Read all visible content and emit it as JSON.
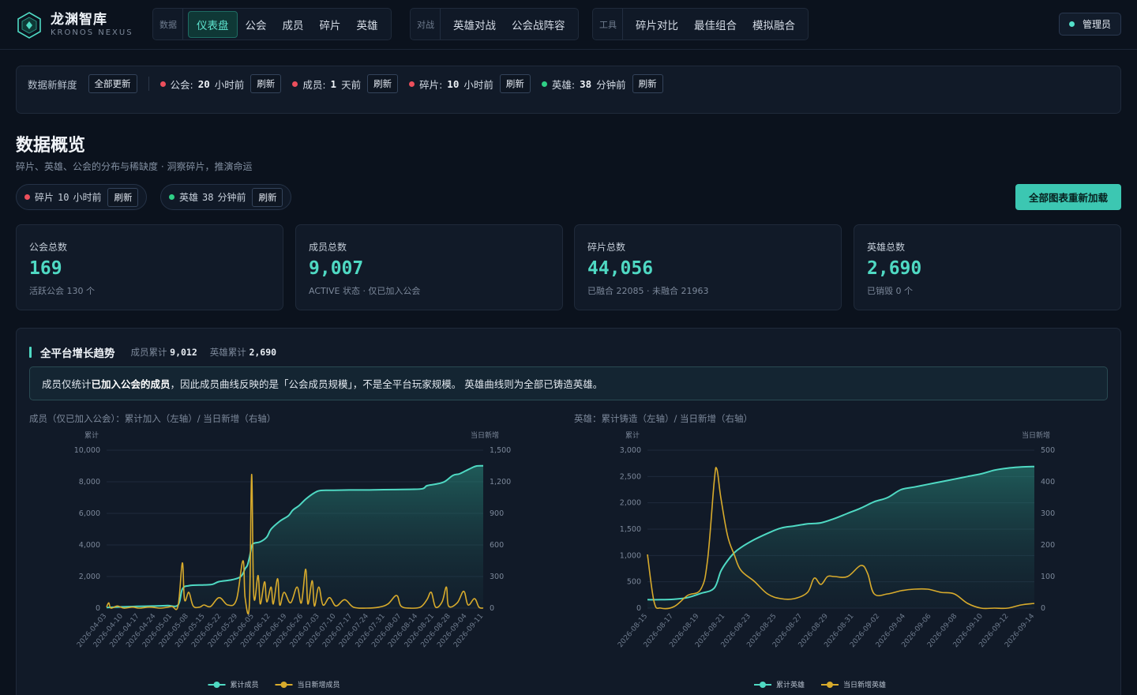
{
  "brand": {
    "name": "龙渊智库",
    "sub": "KRONOS NEXUS"
  },
  "nav": {
    "groups": [
      {
        "label": "数据",
        "items": [
          "仪表盘",
          "公会",
          "成员",
          "碎片",
          "英雄"
        ],
        "active": 0
      },
      {
        "label": "对战",
        "items": [
          "英雄对战",
          "公会战阵容"
        ]
      },
      {
        "label": "工具",
        "items": [
          "碎片对比",
          "最佳组合",
          "模拟融合"
        ]
      }
    ],
    "admin": "管理员"
  },
  "freshness": {
    "label": "数据新鲜度",
    "update_all": "全部更新",
    "items": [
      {
        "name": "公会:",
        "num": "20",
        "unit": "小时前",
        "status": "red",
        "action": "刷新"
      },
      {
        "name": "成员:",
        "num": "1",
        "unit": "天前",
        "status": "red",
        "action": "刷新"
      },
      {
        "name": "碎片:",
        "num": "10",
        "unit": "小时前",
        "status": "red",
        "action": "刷新"
      },
      {
        "name": "英雄:",
        "num": "38",
        "unit": "分钟前",
        "status": "green",
        "action": "刷新"
      }
    ]
  },
  "page": {
    "title": "数据概览",
    "subtitle": "碎片、英雄、公会的分布与稀缺度 · 洞察碎片，推演命运",
    "pills": [
      {
        "name": "碎片",
        "num": "10",
        "unit": "小时前",
        "status": "red",
        "action": "刷新"
      },
      {
        "name": "英雄",
        "num": "38",
        "unit": "分钟前",
        "status": "green",
        "action": "刷新"
      }
    ],
    "reload_all": "全部图表重新加载"
  },
  "stats": [
    {
      "label": "公会总数",
      "value": "169",
      "note": "活跃公会 130 个"
    },
    {
      "label": "成员总数",
      "value": "9,007",
      "note": "ACTIVE 状态 · 仅已加入公会"
    },
    {
      "label": "碎片总数",
      "value": "44,056",
      "note": "已融合 22085 · 未融合 21963"
    },
    {
      "label": "英雄总数",
      "value": "2,690",
      "note": "已销毁 0 个"
    }
  ],
  "growth": {
    "title": "全平台增长趋势",
    "member_total_label": "成员累计",
    "member_total": "9,012",
    "hero_total_label": "英雄累计",
    "hero_total": "2,690",
    "note_pre": "成员仅统计",
    "note_bold": "已加入公会的成员",
    "note_post": "，因此成员曲线反映的是「公会成员规模」，不是全平台玩家规模。 英雄曲线则为全部已铸造英雄。"
  },
  "chart_data": [
    {
      "type": "line",
      "title": "成员（仅已加入公会）：累计加入（左轴）/ 当日新增（右轴）",
      "left_axis_label": "累计",
      "right_axis_label": "当日新增",
      "ylim_left": [
        0,
        10000
      ],
      "ylim_right": [
        0,
        1500
      ],
      "left_ticks": [
        "0",
        "2,000",
        "4,000",
        "6,000",
        "8,000",
        "10,000"
      ],
      "right_ticks": [
        "0",
        "300",
        "600",
        "900",
        "1,200",
        "1,500"
      ],
      "x_labels": [
        "2026-04-03",
        "2026-04-10",
        "2026-04-17",
        "2026-04-24",
        "2026-05-01",
        "2026-05-08",
        "2026-05-15",
        "2026-05-22",
        "2026-05-29",
        "2026-06-05",
        "2026-06-12",
        "2026-06-19",
        "2026-06-26",
        "2026-07-03",
        "2026-07-10",
        "2026-07-17",
        "2026-07-24",
        "2026-07-31",
        "2026-08-07",
        "2026-08-14",
        "2026-08-21",
        "2026-08-28",
        "2026-09-04",
        "2026-09-11"
      ],
      "colors": {
        "cumulative": "#4fd9c3",
        "daily": "#d8ab2c"
      },
      "series": [
        {
          "name": "累计成员",
          "axis": "left",
          "points": [
            [
              0,
              40
            ],
            [
              7,
              80
            ],
            [
              14,
              110
            ],
            [
              21,
              130
            ],
            [
              28,
              160
            ],
            [
              33,
              200
            ],
            [
              35,
              1200
            ],
            [
              38,
              1420
            ],
            [
              45,
              1470
            ],
            [
              49,
              1510
            ],
            [
              52,
              1680
            ],
            [
              58,
              1800
            ],
            [
              62,
              2000
            ],
            [
              64,
              2500
            ],
            [
              65,
              2700
            ],
            [
              66,
              3200
            ],
            [
              67,
              3900
            ],
            [
              68,
              4100
            ],
            [
              71,
              4200
            ],
            [
              74,
              4500
            ],
            [
              76,
              5000
            ],
            [
              80,
              5500
            ],
            [
              84,
              5850
            ],
            [
              86,
              6200
            ],
            [
              89,
              6500
            ],
            [
              92,
              6900
            ],
            [
              96,
              7300
            ],
            [
              99,
              7450
            ],
            [
              105,
              7460
            ],
            [
              112,
              7480
            ],
            [
              120,
              7480
            ],
            [
              128,
              7500
            ],
            [
              140,
              7520
            ],
            [
              146,
              7560
            ],
            [
              148,
              7750
            ],
            [
              152,
              7850
            ],
            [
              156,
              8000
            ],
            [
              160,
              8400
            ],
            [
              163,
              8500
            ],
            [
              166,
              8700
            ],
            [
              169,
              8900
            ],
            [
              171,
              9000
            ],
            [
              174,
              9012
            ]
          ]
        },
        {
          "name": "当日新增成员",
          "axis": "right",
          "points": [
            [
              0,
              10
            ],
            [
              1,
              50
            ],
            [
              2,
              0
            ],
            [
              5,
              20
            ],
            [
              8,
              0
            ],
            [
              12,
              10
            ],
            [
              15,
              0
            ],
            [
              20,
              10
            ],
            [
              25,
              0
            ],
            [
              30,
              15
            ],
            [
              33,
              20
            ],
            [
              35,
              430
            ],
            [
              36,
              80
            ],
            [
              38,
              150
            ],
            [
              40,
              20
            ],
            [
              43,
              10
            ],
            [
              45,
              30
            ],
            [
              48,
              15
            ],
            [
              52,
              100
            ],
            [
              56,
              30
            ],
            [
              60,
              80
            ],
            [
              63,
              450
            ],
            [
              64,
              100
            ],
            [
              66,
              40
            ],
            [
              67,
              1270
            ],
            [
              68,
              120
            ],
            [
              70,
              310
            ],
            [
              71,
              40
            ],
            [
              73,
              250
            ],
            [
              74,
              60
            ],
            [
              76,
              200
            ],
            [
              77,
              40
            ],
            [
              79,
              280
            ],
            [
              80,
              30
            ],
            [
              82,
              150
            ],
            [
              85,
              50
            ],
            [
              88,
              200
            ],
            [
              90,
              50
            ],
            [
              92,
              370
            ],
            [
              93,
              40
            ],
            [
              95,
              260
            ],
            [
              96,
              20
            ],
            [
              98,
              200
            ],
            [
              100,
              30
            ],
            [
              103,
              100
            ],
            [
              106,
              20
            ],
            [
              110,
              80
            ],
            [
              114,
              10
            ],
            [
              120,
              0
            ],
            [
              126,
              10
            ],
            [
              130,
              40
            ],
            [
              134,
              120
            ],
            [
              136,
              20
            ],
            [
              140,
              0
            ],
            [
              145,
              10
            ],
            [
              148,
              80
            ],
            [
              150,
              150
            ],
            [
              152,
              10
            ],
            [
              155,
              60
            ],
            [
              157,
              200
            ],
            [
              158,
              20
            ],
            [
              162,
              50
            ],
            [
              165,
              160
            ],
            [
              167,
              30
            ],
            [
              170,
              90
            ],
            [
              172,
              10
            ],
            [
              174,
              0
            ]
          ]
        }
      ]
    },
    {
      "type": "line",
      "title": "英雄：累计铸造（左轴）/ 当日新增（右轴）",
      "left_axis_label": "累计",
      "right_axis_label": "当日新增",
      "ylim_left": [
        0,
        3000
      ],
      "ylim_right": [
        0,
        500
      ],
      "left_ticks": [
        "0",
        "500",
        "1,000",
        "1,500",
        "2,000",
        "2,500",
        "3,000"
      ],
      "right_ticks": [
        "0",
        "100",
        "200",
        "300",
        "400",
        "500"
      ],
      "x_labels": [
        "2026-08-15",
        "2026-08-17",
        "2026-08-19",
        "2026-08-21",
        "2026-08-23",
        "2026-08-25",
        "2026-08-27",
        "2026-08-29",
        "2026-08-31",
        "2026-09-02",
        "2026-09-04",
        "2026-09-06",
        "2026-09-08",
        "2026-09-10",
        "2026-09-12",
        "2026-09-14"
      ],
      "colors": {
        "cumulative": "#4fd9c3",
        "daily": "#d8ab2c"
      },
      "series": [
        {
          "name": "累计英雄",
          "axis": "left",
          "points": [
            [
              0,
              160
            ],
            [
              1,
              160
            ],
            [
              2,
              170
            ],
            [
              3,
              200
            ],
            [
              4,
              280
            ],
            [
              5,
              380
            ],
            [
              5.5,
              700
            ],
            [
              6,
              900
            ],
            [
              6.5,
              1050
            ],
            [
              7,
              1150
            ],
            [
              8,
              1300
            ],
            [
              9,
              1420
            ],
            [
              10,
              1520
            ],
            [
              11,
              1560
            ],
            [
              12,
              1600
            ],
            [
              13,
              1620
            ],
            [
              14,
              1700
            ],
            [
              15,
              1800
            ],
            [
              16,
              1900
            ],
            [
              17,
              2020
            ],
            [
              18,
              2100
            ],
            [
              19,
              2250
            ],
            [
              20,
              2300
            ],
            [
              21,
              2350
            ],
            [
              22,
              2400
            ],
            [
              23,
              2450
            ],
            [
              24,
              2500
            ],
            [
              25,
              2550
            ],
            [
              26,
              2620
            ],
            [
              27,
              2660
            ],
            [
              28,
              2680
            ],
            [
              29,
              2690
            ]
          ]
        },
        {
          "name": "当日新增英雄",
          "axis": "right",
          "points": [
            [
              0,
              170
            ],
            [
              0.5,
              20
            ],
            [
              1,
              0
            ],
            [
              2,
              5
            ],
            [
              3,
              40
            ],
            [
              4,
              60
            ],
            [
              4.5,
              150
            ],
            [
              5,
              400
            ],
            [
              5.2,
              440
            ],
            [
              5.5,
              350
            ],
            [
              6,
              230
            ],
            [
              6.5,
              170
            ],
            [
              7,
              120
            ],
            [
              8,
              85
            ],
            [
              9,
              45
            ],
            [
              10,
              30
            ],
            [
              11,
              30
            ],
            [
              12,
              50
            ],
            [
              12.5,
              95
            ],
            [
              13,
              75
            ],
            [
              13.5,
              100
            ],
            [
              14,
              100
            ],
            [
              15,
              100
            ],
            [
              16,
              135
            ],
            [
              16.5,
              110
            ],
            [
              17,
              45
            ],
            [
              18,
              45
            ],
            [
              19,
              55
            ],
            [
              20,
              60
            ],
            [
              21,
              60
            ],
            [
              22,
              50
            ],
            [
              23,
              45
            ],
            [
              24,
              15
            ],
            [
              25,
              0
            ],
            [
              26,
              0
            ],
            [
              27,
              0
            ],
            [
              28,
              10
            ],
            [
              29,
              15
            ]
          ]
        }
      ]
    }
  ]
}
